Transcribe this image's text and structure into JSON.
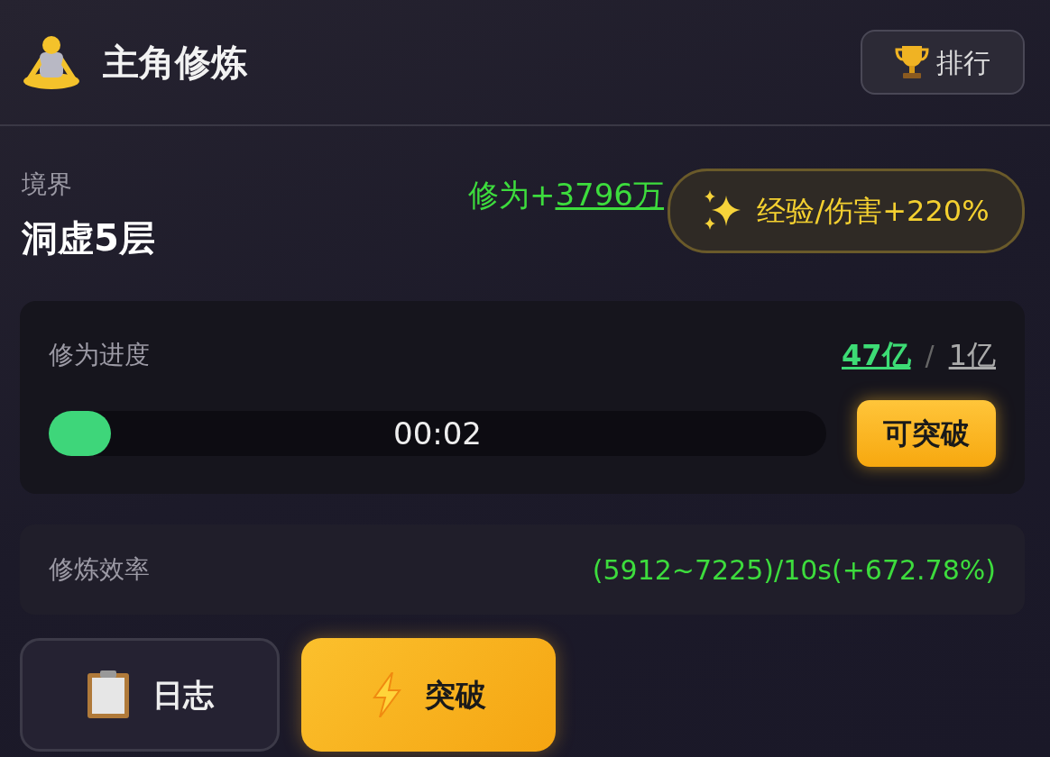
{
  "header": {
    "title": "主角修炼",
    "rank_button": "排行"
  },
  "realm": {
    "label": "境界",
    "value": "洞虚5层",
    "gain_prefix": "修为+",
    "gain_value": "3796万",
    "bonus": "经验/伤害+220%"
  },
  "progress": {
    "label": "修为进度",
    "current": "47亿",
    "separator": "/",
    "target": "1亿",
    "level": 0.08,
    "time": "00:02",
    "breakthrough_ready": true,
    "ready_button": "可突破"
  },
  "efficiency": {
    "label": "修炼效率",
    "value": "(5912~7225)/10s(+672.78%)"
  },
  "buttons": [
    {
      "kind": "log",
      "label": "日志"
    },
    {
      "kind": "breakthrough",
      "label": "突破"
    }
  ]
}
